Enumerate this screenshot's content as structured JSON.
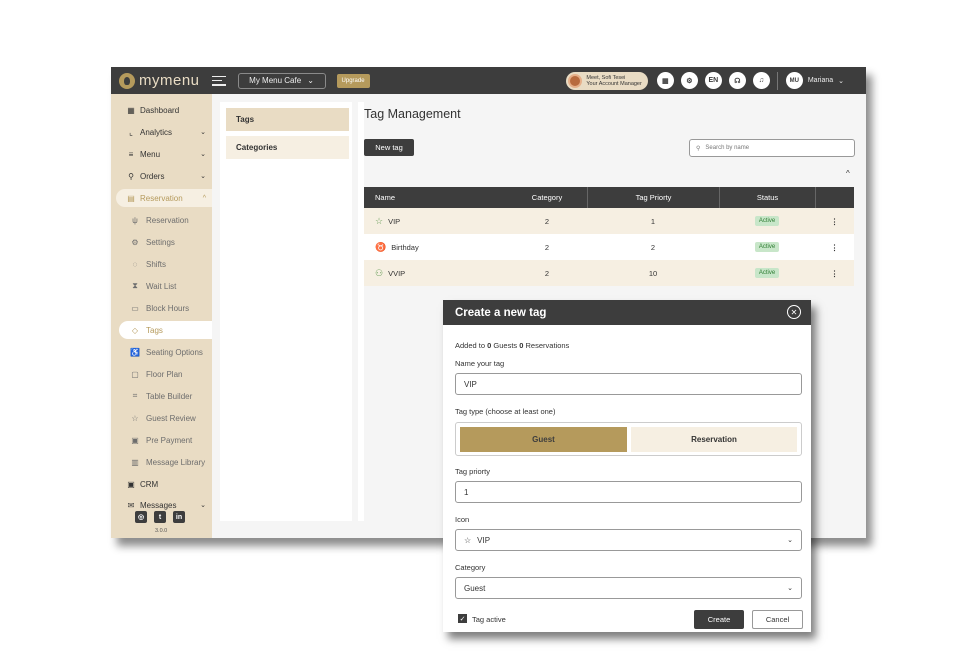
{
  "header": {
    "logo": "mymenu",
    "cafe": "My Menu Cafe",
    "upgrade": "Upgrade",
    "manager_line1": "Meet, Sofi Tesei",
    "manager_line2": "Your Account Manager",
    "lang": "EN",
    "user_initials": "MU",
    "user_name": "Mariana"
  },
  "sidebar": {
    "items": [
      {
        "label": "Dashboard",
        "icon": "dashboard-icon"
      },
      {
        "label": "Analytics",
        "icon": "analytics-icon"
      },
      {
        "label": "Menu",
        "icon": "menu-icon"
      },
      {
        "label": "Orders",
        "icon": "orders-icon"
      },
      {
        "label": "Reservation",
        "icon": "reservation-icon"
      },
      {
        "label": "Reservation",
        "icon": "cutlery-icon"
      },
      {
        "label": "Settings",
        "icon": "gear-icon"
      },
      {
        "label": "Shifts",
        "icon": "shifts-icon"
      },
      {
        "label": "Wait List",
        "icon": "hourglass-icon"
      },
      {
        "label": "Block Hours",
        "icon": "block-icon"
      },
      {
        "label": "Tags",
        "icon": "tag-icon"
      },
      {
        "label": "Seating Options",
        "icon": "seat-icon"
      },
      {
        "label": "Floor Plan",
        "icon": "floor-plan-icon"
      },
      {
        "label": "Table Builder",
        "icon": "table-icon"
      },
      {
        "label": "Guest Review",
        "icon": "review-icon"
      },
      {
        "label": "Pre Payment",
        "icon": "payment-icon"
      },
      {
        "label": "Message Library",
        "icon": "library-icon"
      },
      {
        "label": "CRM",
        "icon": "crm-icon"
      },
      {
        "label": "Messages",
        "icon": "messages-icon"
      }
    ],
    "version": "3.0.0"
  },
  "subnav": {
    "tags": "Tags",
    "categories": "Categories"
  },
  "main": {
    "title": "Tag Management",
    "new_tag": "New tag",
    "search_placeholder": "Search by name",
    "columns": [
      "Name",
      "Category",
      "Tag Priorty",
      "Status"
    ],
    "rows": [
      {
        "name": "VIP",
        "category": "2",
        "priority": "1",
        "status": "Active",
        "icon": "star-icon"
      },
      {
        "name": "Birthday",
        "category": "2",
        "priority": "2",
        "status": "Active",
        "icon": "trophy-icon"
      },
      {
        "name": "VVIP",
        "category": "2",
        "priority": "10",
        "status": "Active",
        "icon": "person-check-icon"
      }
    ]
  },
  "modal": {
    "title": "Create a new tag",
    "added_prefix": "Added to",
    "guests_count": "0",
    "guests_label": "Guests",
    "reservations_count": "0",
    "reservations_label": "Reservations",
    "name_label": "Name your tag",
    "name_value": "VIP",
    "type_label": "Tag type (choose at least one)",
    "type_guest": "Guest",
    "type_reservation": "Reservation",
    "priority_label": "Tag priorty",
    "priority_value": "1",
    "icon_label": "Icon",
    "icon_value": "VIP",
    "category_label": "Category",
    "category_value": "Guest",
    "active_label": "Tag active",
    "create": "Create",
    "cancel": "Cancel"
  },
  "colors": {
    "dark": "#3d3d3d",
    "accent": "#b59a5c",
    "beige": "#e9dcc4",
    "active_badge": "#c8e6c9"
  }
}
